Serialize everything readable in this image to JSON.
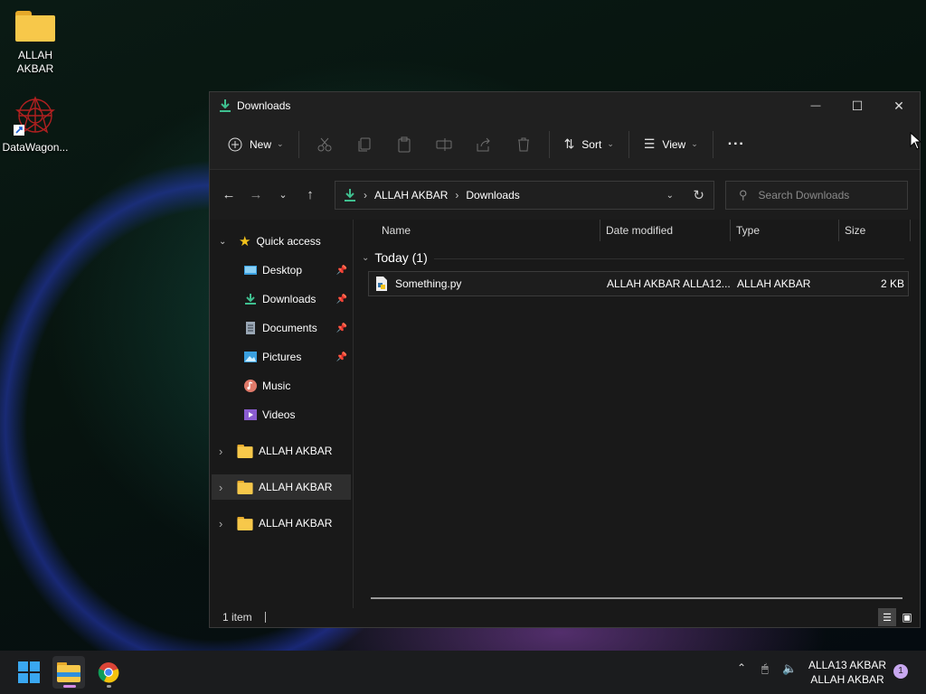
{
  "desktop": {
    "icons": [
      {
        "label": "ALLAH AKBAR",
        "icon": "folder-icon"
      },
      {
        "label": "DataWagon...",
        "icon": "datawagon-shortcut-icon"
      }
    ]
  },
  "window": {
    "title": "Downloads",
    "controls": {
      "minimize": "—",
      "maximize": "☐",
      "close": "✕"
    },
    "toolbar": {
      "new_label": "New",
      "sort_label": "Sort",
      "view_label": "View",
      "more_label": "···"
    },
    "address": {
      "crumbs": [
        "ALLAH AKBAR",
        "Downloads"
      ],
      "search_placeholder": "Search Downloads"
    },
    "sidebar": {
      "quick_access": "Quick access",
      "items": [
        {
          "label": "Desktop",
          "pinned": true
        },
        {
          "label": "Downloads",
          "pinned": true
        },
        {
          "label": "Documents",
          "pinned": true
        },
        {
          "label": "Pictures",
          "pinned": true
        },
        {
          "label": "Music",
          "pinned": false
        },
        {
          "label": "Videos",
          "pinned": false
        }
      ],
      "folders": [
        {
          "label": "ALLAH AKBAR",
          "selected": false
        },
        {
          "label": "ALLAH AKBAR",
          "selected": true
        },
        {
          "label": "ALLAH AKBAR",
          "selected": false
        }
      ]
    },
    "columns": {
      "name": "Name",
      "date": "Date modified",
      "type": "Type",
      "size": "Size"
    },
    "group": "Today (1)",
    "files": [
      {
        "name": "Something.py",
        "date": "ALLAH AKBAR ALLA12...",
        "type": "ALLAH AKBAR",
        "size": "2 KB"
      }
    ],
    "status": "1 item"
  },
  "taskbar": {
    "clock_line1": "ALLA13 AKBAR",
    "clock_line2": "ALLAH AKBAR",
    "notifications": "1"
  },
  "colors": {
    "accent": "#4cc2ff",
    "download_green": "#3fbf8f",
    "folder": "#f7c84a"
  }
}
